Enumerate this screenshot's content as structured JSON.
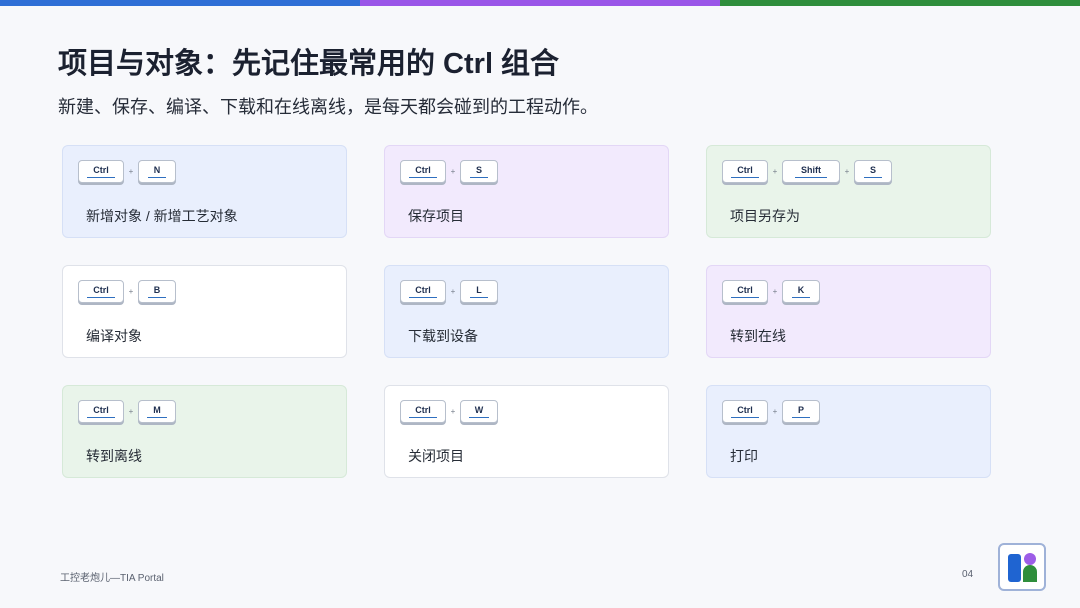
{
  "colors": {
    "accent_blue": "#2f6fd6",
    "accent_purple": "#9a56e8",
    "accent_green": "#2f8e3c"
  },
  "header": {
    "title": "项目与对象：先记住最常用的 Ctrl 组合",
    "subtitle": "新建、保存、编译、下载和在线离线，是每天都会碰到的工程动作。"
  },
  "cards": [
    {
      "keys": [
        "Ctrl",
        "N"
      ],
      "label": "新增对象 / 新增工艺对象",
      "tone": "blue"
    },
    {
      "keys": [
        "Ctrl",
        "S"
      ],
      "label": "保存项目",
      "tone": "purple"
    },
    {
      "keys": [
        "Ctrl",
        "Shift",
        "S"
      ],
      "label": "项目另存为",
      "tone": "green"
    },
    {
      "keys": [
        "Ctrl",
        "B"
      ],
      "label": "编译对象",
      "tone": "white"
    },
    {
      "keys": [
        "Ctrl",
        "L"
      ],
      "label": "下载到设备",
      "tone": "blue"
    },
    {
      "keys": [
        "Ctrl",
        "K"
      ],
      "label": "转到在线",
      "tone": "purple"
    },
    {
      "keys": [
        "Ctrl",
        "M"
      ],
      "label": "转到离线",
      "tone": "green"
    },
    {
      "keys": [
        "Ctrl",
        "W"
      ],
      "label": "关闭项目",
      "tone": "white"
    },
    {
      "keys": [
        "Ctrl",
        "P"
      ],
      "label": "打印",
      "tone": "blue"
    }
  ],
  "plus_sign": "+",
  "footer": {
    "brand": "工控老炮儿—TIA Portal",
    "page_number": "04",
    "logo_icon": "brand-logo-icon"
  }
}
